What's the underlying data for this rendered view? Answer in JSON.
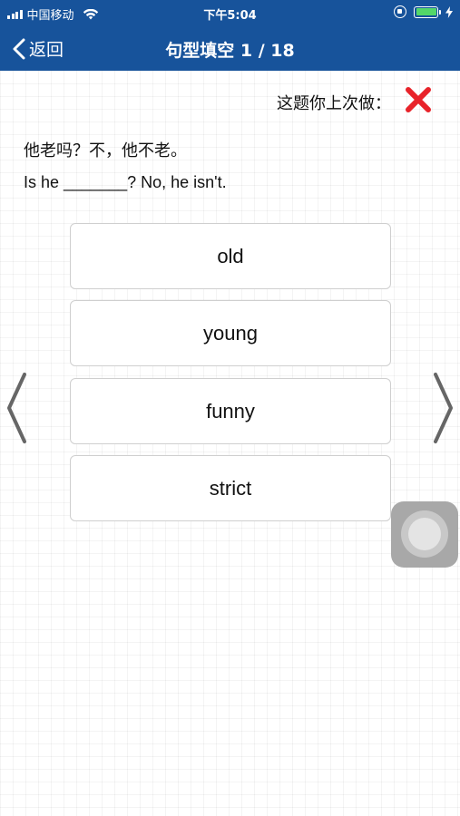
{
  "status_bar": {
    "carrier": "中国移动",
    "time": "下午5:04"
  },
  "nav": {
    "back_label": "返回",
    "title": "句型填空 1 / 18"
  },
  "question": {
    "last_attempt_label": "这题你上次做：",
    "last_attempt_result_icon": "red-cross-icon",
    "chinese": "他老吗？不，他不老。",
    "english": "Is he _______? No, he isn't."
  },
  "options": [
    {
      "label": "old"
    },
    {
      "label": "young"
    },
    {
      "label": "funny"
    },
    {
      "label": "strict"
    }
  ],
  "colors": {
    "header_blue": "#17539b",
    "wrong_red": "#e8232a"
  }
}
